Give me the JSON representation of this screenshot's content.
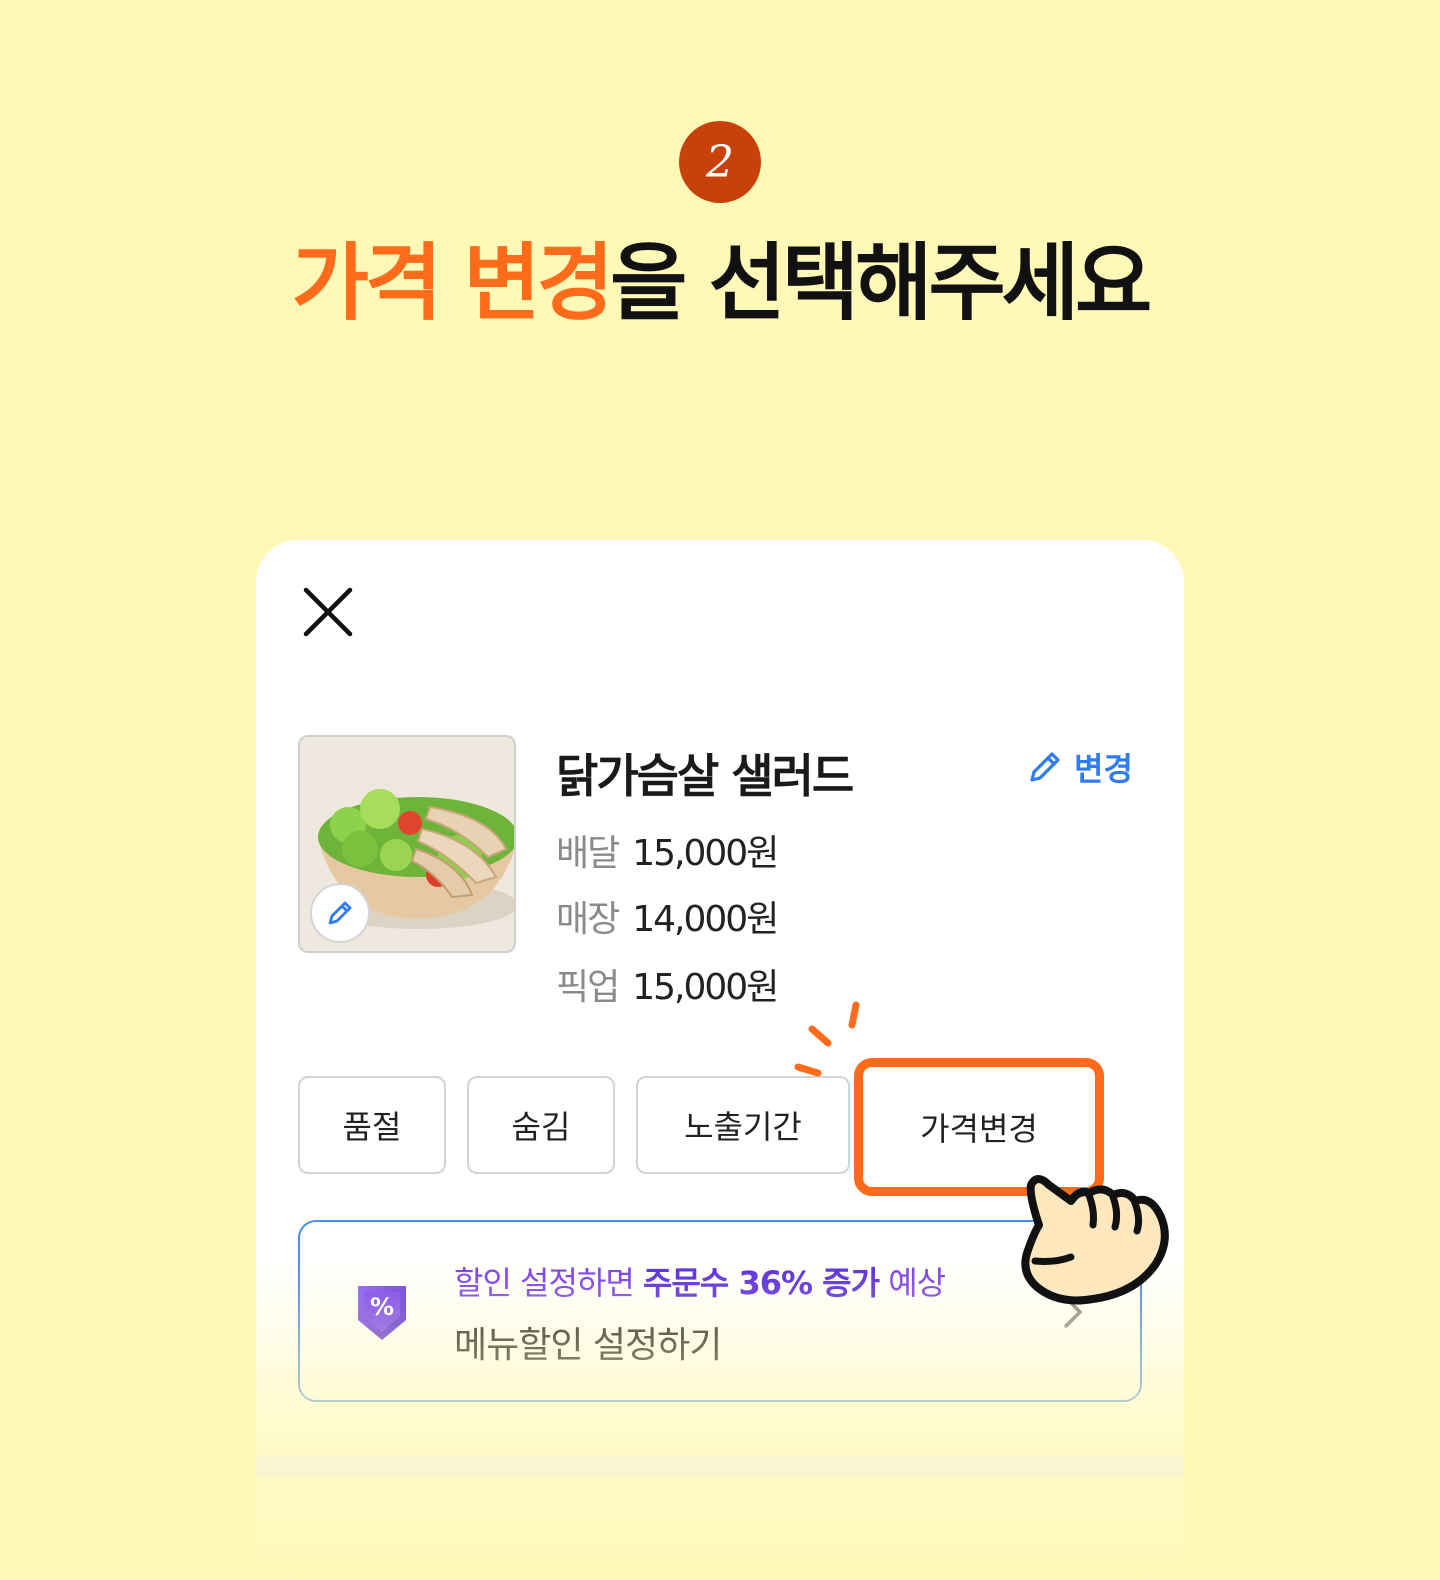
{
  "step": {
    "number": "2"
  },
  "headline": {
    "accent": "가격 변경",
    "rest": "을 선택해주세요"
  },
  "product": {
    "name": "닭가슴살 샐러드",
    "edit_label": "변경",
    "prices": [
      {
        "label": "배달",
        "value": "15,000원"
      },
      {
        "label": "매장",
        "value": "14,000원"
      },
      {
        "label": "픽업",
        "value": "15,000원"
      }
    ]
  },
  "actions": {
    "soldout": "품절",
    "hide": "숨김",
    "display_period": "노출기간",
    "price_change": "가격변경"
  },
  "promo": {
    "sub_prefix": "할인 설정하면 ",
    "sub_bold": "주문수 36% 증가",
    "sub_suffix": " 예상",
    "main": "메뉴할인 설정하기",
    "badge_symbol": "%"
  },
  "colors": {
    "background": "#FFF9B8",
    "accent": "#FF6B1A",
    "link": "#2F7BEF",
    "promo_purple": "#7B3FF0"
  },
  "icons": [
    "close-icon",
    "pencil-icon",
    "discount-badge-icon",
    "chevron-right-icon",
    "pointing-hand-icon"
  ]
}
